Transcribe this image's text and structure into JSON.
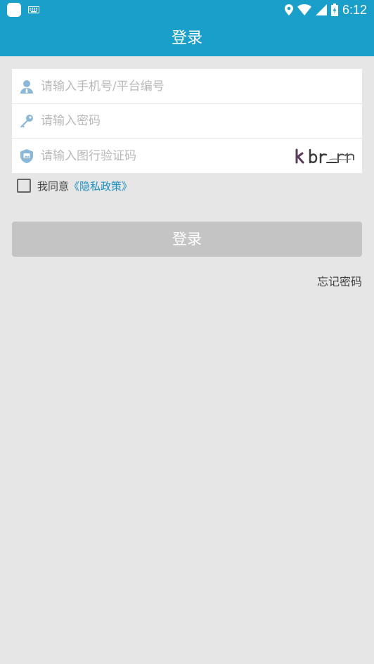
{
  "status_bar": {
    "time": "6:12",
    "icons": [
      "app-icon",
      "keyboard-icon",
      "location-icon",
      "wifi-icon",
      "cellular-signal-icon",
      "battery-charging-icon"
    ]
  },
  "app_bar": {
    "title": "登录"
  },
  "form": {
    "account_placeholder": "请输入手机号/平台编号",
    "password_placeholder": "请输入密码",
    "captcha_placeholder": "请输入图行验证码",
    "captcha_text": "kbr_r"
  },
  "agreement": {
    "checked": false,
    "prefix": "我同意",
    "policy_link": "《隐私政策》"
  },
  "login_button": "登录",
  "forgot_password": "忘记密码",
  "colors": {
    "primary": "#1a9fcb",
    "background": "#e6e6e6",
    "button_disabled": "#c4c4c4",
    "link": "#1a8fc0",
    "icon": "#8bb8d8"
  }
}
